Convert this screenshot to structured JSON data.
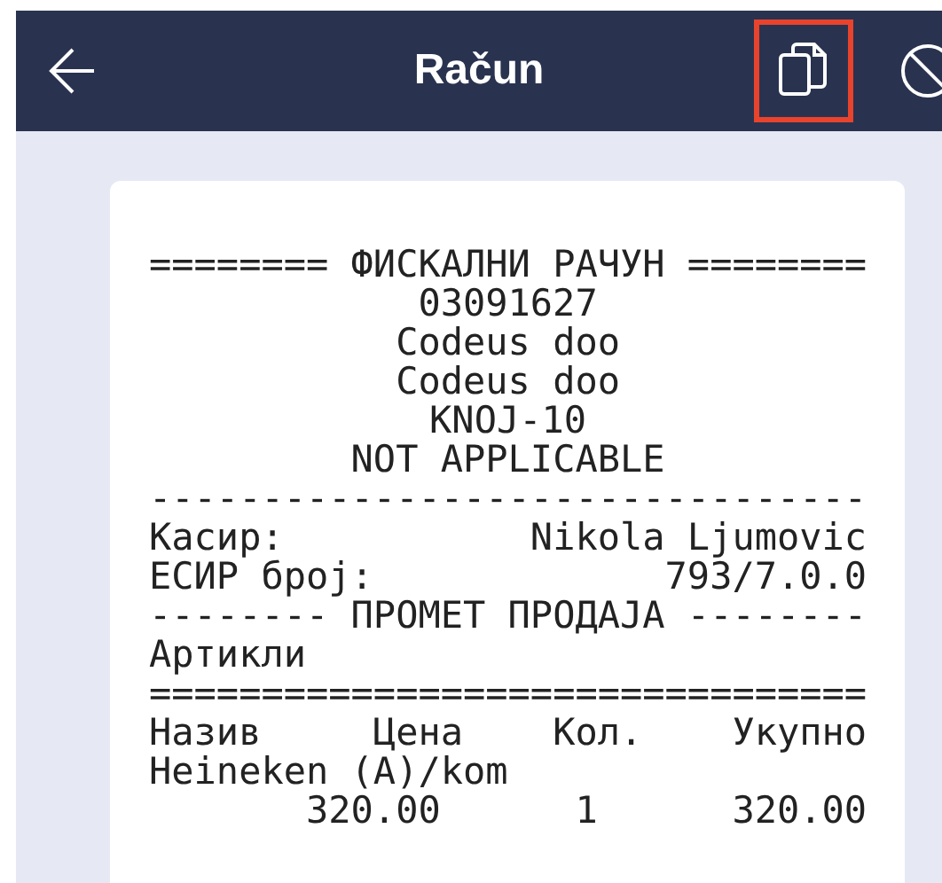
{
  "app_bar": {
    "title": "Račun",
    "actions": [
      {
        "kind": "copy",
        "highlighted": true
      },
      {
        "kind": "block",
        "highlighted": false
      }
    ]
  },
  "receipt": {
    "lines": [
      {
        "kind": "center",
        "text": "======== ФИСКАЛНИ РАЧУН ========"
      },
      {
        "kind": "center",
        "text": "03091627"
      },
      {
        "kind": "center",
        "text": "Codeus doo"
      },
      {
        "kind": "center",
        "text": "Codeus doo"
      },
      {
        "kind": "center",
        "text": "KNOJ-10"
      },
      {
        "kind": "center",
        "text": "NOT APPLICABLE"
      },
      {
        "kind": "center",
        "text": "--------------------------------"
      },
      {
        "kind": "pair",
        "left": "Касир:",
        "right": "Nikola Ljumovic"
      },
      {
        "kind": "pair",
        "left": "ЕСИР број:",
        "right": "793/7.0.0"
      },
      {
        "kind": "center",
        "text": "-------- ПРОМЕТ ПРОДАЈА --------"
      },
      {
        "kind": "left",
        "text": "Артикли"
      },
      {
        "kind": "center",
        "text": "================================"
      },
      {
        "kind": "header",
        "cells": [
          "Назив",
          "Цена",
          "Кол.",
          "Укупно"
        ]
      },
      {
        "kind": "left",
        "text": "Heineken (A)/kom"
      },
      {
        "kind": "values",
        "cells": [
          "320.00",
          "1",
          "320.00"
        ]
      }
    ]
  }
}
